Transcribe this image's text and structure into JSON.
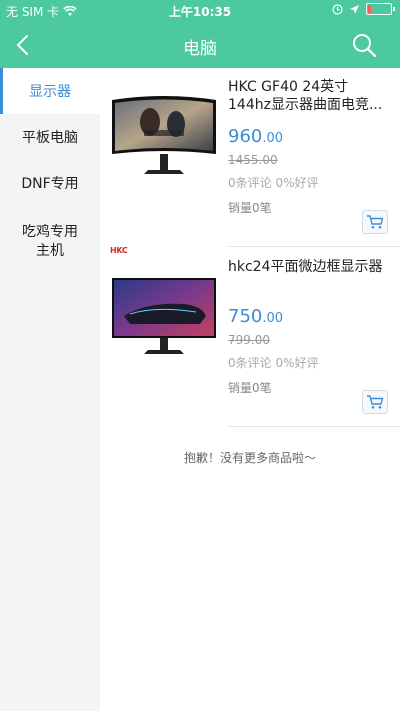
{
  "status": {
    "carrier": "无 SIM 卡",
    "time": "上午10:35",
    "battery_level": 0.15,
    "icons": [
      "wifi-icon",
      "alarm-icon",
      "location-arrow-icon",
      "battery-icon"
    ]
  },
  "nav": {
    "title": "电脑",
    "back_icon": "chevron-left-icon",
    "search_icon": "search-icon"
  },
  "sidebar": {
    "items": [
      {
        "label": "显示器",
        "active": true
      },
      {
        "label": "平板电脑",
        "active": false
      },
      {
        "label": "DNF专用",
        "active": false
      },
      {
        "label": "吃鸡专用\n主机",
        "active": false
      }
    ]
  },
  "products": [
    {
      "name": "HKC GF40 24英寸144hz显示器曲面电竞...",
      "price_int": "960",
      "price_dec": ".00",
      "old_price": "1455.00",
      "reviews": "0条评论 0%好评",
      "sales": "销量0笔"
    },
    {
      "name": "hkc24平面微边框显示器",
      "brand_mark": "HKC",
      "price_int": "750",
      "price_dec": ".00",
      "old_price": "799.00",
      "reviews": "0条评论 0%好评",
      "sales": "销量0笔"
    }
  ],
  "end_text": "抱歉！没有更多商品啦～",
  "colors": {
    "primary_green": "#4cc99f",
    "accent_blue": "#3d8dd6",
    "sidebar_bg": "#f4f4f4"
  }
}
